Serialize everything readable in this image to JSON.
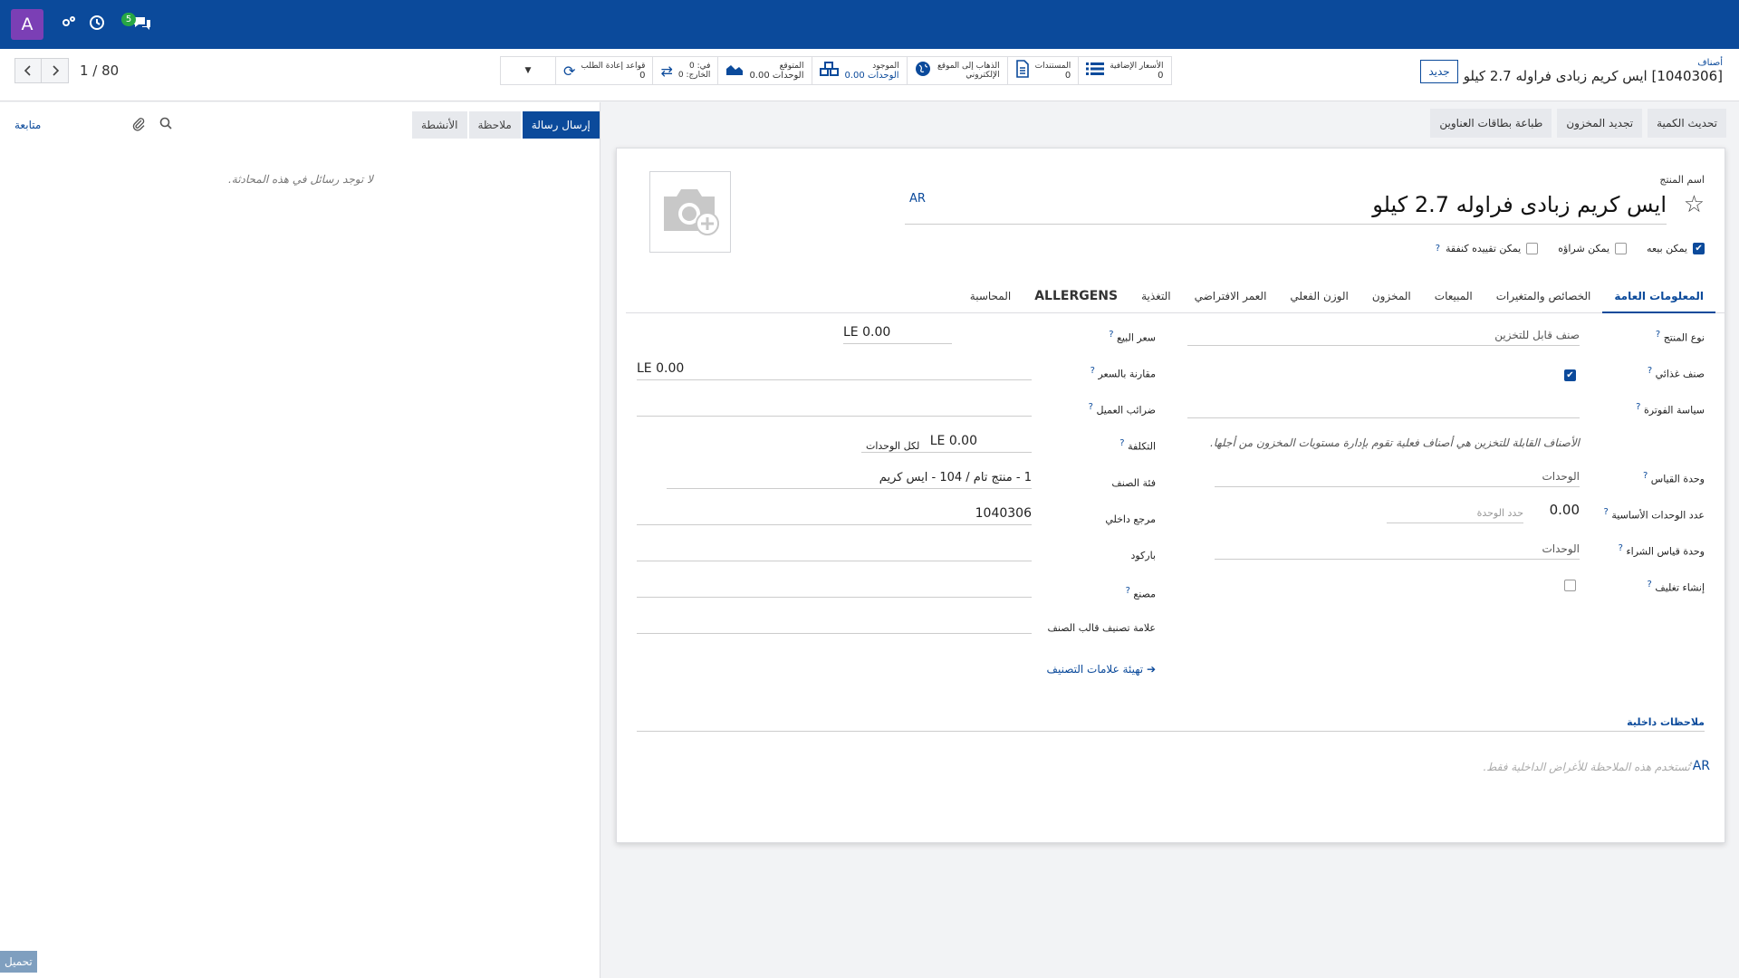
{
  "topbar": {
    "avatar": "A",
    "chat_count": "5"
  },
  "pager": {
    "text": "1 / 80"
  },
  "smart_buttons": [
    {
      "label": "الأسعار الإضافية",
      "value": "0",
      "icon": "list-icon"
    },
    {
      "label": "المستندات",
      "value": "0",
      "icon": "file-icon"
    },
    {
      "label": "الذهاب إلى الموقع الإلكتروني",
      "value": "",
      "icon": "globe-icon"
    },
    {
      "label": "الموجود",
      "value": "0.00 الوحدات",
      "icon": "cubes-icon"
    },
    {
      "label": "المتوقع",
      "value": "0.00 الوحدات",
      "icon": "area-chart-icon"
    },
    {
      "label": "في: 0",
      "value": "الخارج: 0",
      "icon": "exchange-icon"
    },
    {
      "label": "قواعد إعادة الطلب",
      "value": "0",
      "icon": "refresh-icon"
    }
  ],
  "breadcrumb": {
    "parent": "أصناف",
    "current": "[1040306] ايس كريم زبادى فراوله 2.7 كيلو",
    "new_label": "جديد"
  },
  "chatter": {
    "send_label": "إرسال رسالة",
    "note_label": "ملاحظة",
    "activities_label": "الأنشطة",
    "follow_label": "متابعة",
    "empty": "لا توجد رسائل في هذه المحادثة.",
    "upload_label": "تحميل"
  },
  "actions": {
    "update_qty": "تحديث الكمية",
    "replenish": "تجديد المخزون",
    "print_labels": "طباعة بطاقات العناوين"
  },
  "product": {
    "name_label": "اسم المنتج",
    "name": "ايس كريم زبادى فراوله 2.7 كيلو",
    "lang": "AR",
    "can_sell": "يمكن بيعه",
    "can_purchase": "يمكن شراؤه",
    "can_expense": "يمكن تقييده كنفقة"
  },
  "tabs": [
    "المعلومات العامة",
    "الخصائص والمتغيرات",
    "المبيعات",
    "المخزون",
    "الوزن الفعلي",
    "العمر الافتراضي",
    "التغذية",
    "ALLERGENS",
    "المحاسبة"
  ],
  "left_col": {
    "product_type_label": "نوع المنتج",
    "product_type": "صنف قابل للتخزين",
    "food_label": "صنف غذائي",
    "invoice_policy_label": "سياسة الفوترة",
    "hint": "الأصناف القابلة للتخزين هي أصناف فعلية تقوم بإدارة مستويات المخزون من أجلها.",
    "uom_label": "وحدة القياس",
    "uom": "الوحدات",
    "base_units_label": "عدد الوحدات الأساسية",
    "base_units": "0.00",
    "unit_limit_ph": "حدد الوحدة",
    "purchase_uom_label": "وحدة قياس الشراء",
    "purchase_uom": "الوحدات",
    "packaging_label": "إنشاء تغليف"
  },
  "right_col": {
    "sale_price_label": "سعر البيع",
    "sale_price": "LE 0.00",
    "compare_label": "مقارنة بالسعر",
    "compare": "LE 0.00",
    "taxes_label": "ضرائب العميل",
    "cost_label": "التكلفة",
    "cost": "LE 0.00",
    "cost_unit": "لكل الوحدات",
    "category_label": "فئة الصنف",
    "category": "1 - منتج تام / 104 - ايس كريم",
    "ref_label": "مرجع داخلي",
    "ref": "1040306",
    "barcode_label": "باركود",
    "factory_label": "مصنع",
    "tag_label": "علامة تصنيف قالب الصنف",
    "config_tags": "تهيئة علامات التصنيف"
  },
  "notes": {
    "label": "ملاحظات داخلية",
    "placeholder": "تُستخدم هذه الملاحظة للأغراض الداخلية فقط.",
    "lang": "AR"
  }
}
